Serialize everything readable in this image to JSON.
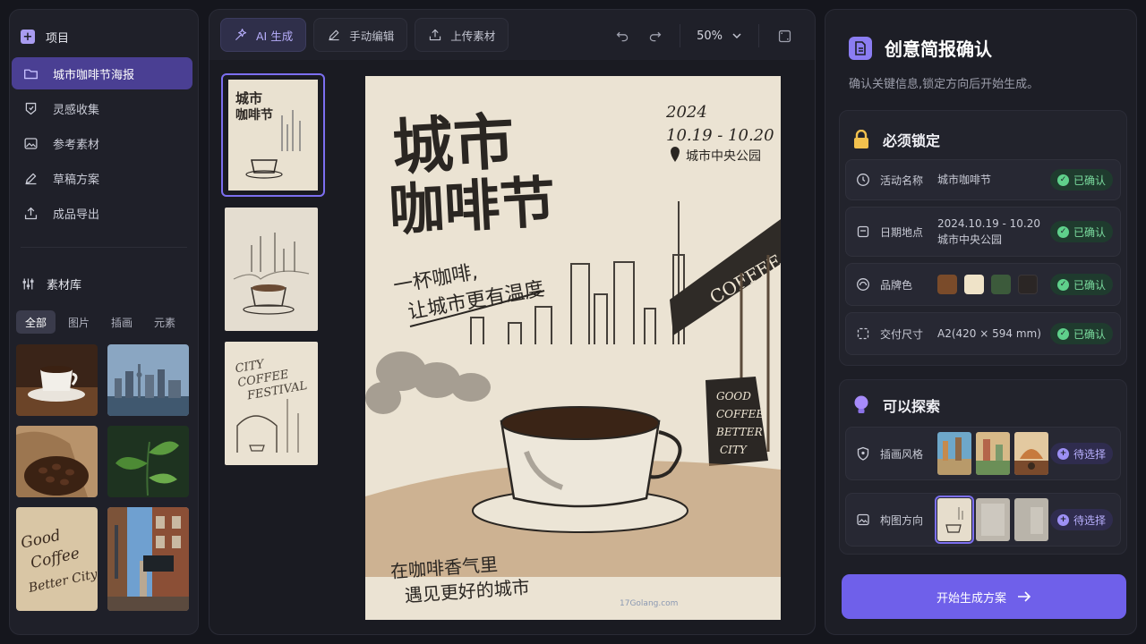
{
  "sidebar": {
    "project_label": "项目",
    "nav": [
      {
        "label": "城市咖啡节海报",
        "icon": "folder-icon",
        "active": true
      },
      {
        "label": "灵感收集",
        "icon": "bulb-tag-icon"
      },
      {
        "label": "参考素材",
        "icon": "image-icon"
      },
      {
        "label": "草稿方案",
        "icon": "pencil-icon"
      },
      {
        "label": "成品导出",
        "icon": "export-icon"
      }
    ],
    "library_label": "素材库",
    "library_tabs": [
      "全部",
      "图片",
      "插画",
      "元素"
    ],
    "library_active_tab": "全部",
    "library_thumbs": [
      "coffee-cup",
      "city-skyline",
      "coffee-beans",
      "green-leaves",
      "good-coffee-sign",
      "street-shopfront"
    ]
  },
  "toolbar": {
    "ai_label": "AI 生成",
    "manual_label": "手动编辑",
    "upload_label": "上传素材",
    "zoom": "50%"
  },
  "poster": {
    "title_line1": "城市",
    "title_line2": "咖啡节",
    "year": "2024",
    "dates": "10.19 - 10.20",
    "venue": "城市中央公园",
    "slogan_line1": "一杯咖啡,",
    "slogan_line2": "让城市更有温度",
    "footer_line1": "在咖啡香气里",
    "footer_line2": "遇见更好的城市",
    "shop_sign": "COFFEE",
    "board_lines": [
      "GOOD",
      "COFFEE",
      "BETTER",
      "CITY"
    ],
    "watermark": "17Golang.com"
  },
  "library_sign": [
    "Good",
    "Coffee",
    "Better City"
  ],
  "page_thumb3": [
    "CITY",
    "COFFEE",
    "FESTIVAL"
  ],
  "brief": {
    "title": "创意简报确认",
    "subtitle": "确认关键信息,锁定方向后开始生成。",
    "locked_title": "必须锁定",
    "locked_rows": [
      {
        "label": "活动名称",
        "value": "城市咖啡节",
        "status": "已确认"
      },
      {
        "label": "日期地点",
        "value_line1": "2024.10.19 - 10.20",
        "value_line2": "城市中央公园",
        "status": "已确认"
      },
      {
        "label": "品牌色",
        "colors": [
          "#7a4b2a",
          "#efe3c8",
          "#3c5a3b",
          "#2b2625"
        ],
        "status": "已确认"
      },
      {
        "label": "交付尺寸",
        "value": "A2(420 × 594 mm)",
        "status": "已确认"
      }
    ],
    "explore_title": "可以探索",
    "explore_rows": [
      {
        "label": "插画风格",
        "status": "待选择"
      },
      {
        "label": "构图方向",
        "status": "待选择"
      }
    ],
    "cta_label": "开始生成方案"
  }
}
